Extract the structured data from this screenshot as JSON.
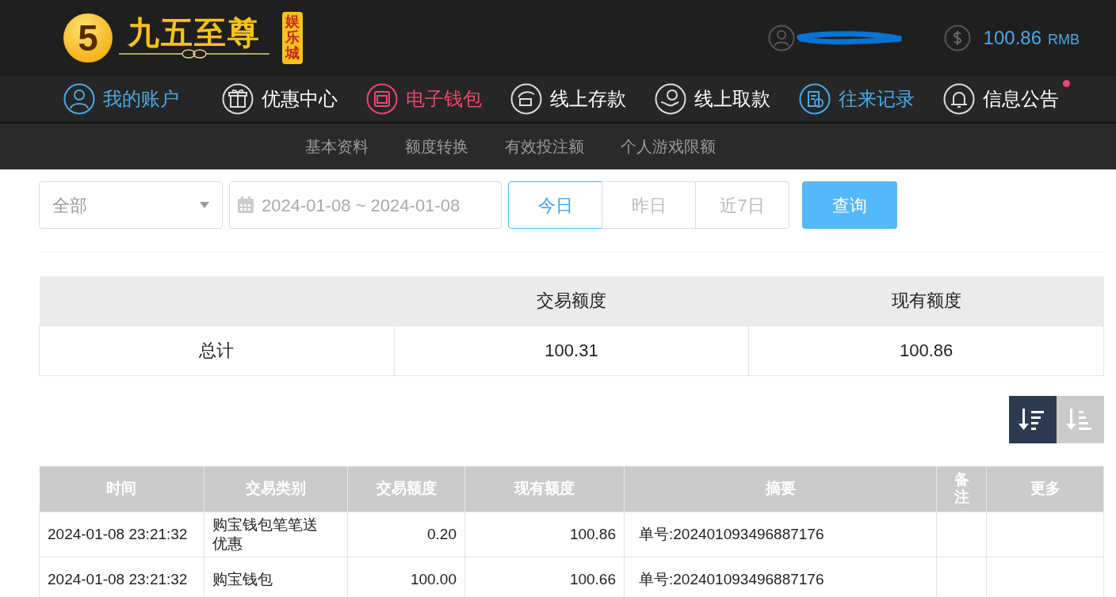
{
  "header": {
    "logo": {
      "mark": "5",
      "name": "九五至尊",
      "tag": "娱乐城"
    },
    "balance": {
      "amount": "100.86",
      "currency": "RMB"
    }
  },
  "nav": [
    {
      "label": "我的账户",
      "color": "#4aa8e8"
    },
    {
      "label": "优惠中心",
      "color": "#ffffff"
    },
    {
      "label": "电子钱包",
      "color": "#f0466e"
    },
    {
      "label": "线上存款",
      "color": "#ffffff"
    },
    {
      "label": "线上取款",
      "color": "#ffffff"
    },
    {
      "label": "往来记录",
      "color": "#4aa8e8"
    },
    {
      "label": "信息公告",
      "color": "#ffffff",
      "unread": true
    }
  ],
  "subnav": [
    "基本资料",
    "额度转换",
    "有效投注额",
    "个人游戏限额"
  ],
  "filter": {
    "type": "全部",
    "date_range": "2024-01-08 ~ 2024-01-08",
    "ranges": [
      {
        "label": "今日",
        "selected": true
      },
      {
        "label": "昨日",
        "selected": false
      },
      {
        "label": "近7日",
        "selected": false
      }
    ],
    "query": "查询"
  },
  "summary": {
    "columns": [
      "",
      "交易额度",
      "现有额度"
    ],
    "rows": [
      [
        "总计",
        "100.31",
        "100.86"
      ]
    ]
  },
  "sort": [
    {
      "kind": "desc",
      "selected": true
    },
    {
      "kind": "asc",
      "selected": false
    }
  ],
  "table": {
    "columns": [
      "时间",
      "交易类别",
      "交易额度",
      "现有额度",
      "摘要",
      "备注",
      "更多"
    ],
    "rows": [
      [
        "2024-01-08 23:21:32",
        "购宝钱包笔笔送优惠",
        "0.20",
        "100.86",
        "单号:202401093496887176",
        "",
        ""
      ],
      [
        "2024-01-08 23:21:32",
        "购宝钱包",
        "100.00",
        "100.66",
        "单号:202401093496887176",
        "",
        ""
      ]
    ]
  }
}
